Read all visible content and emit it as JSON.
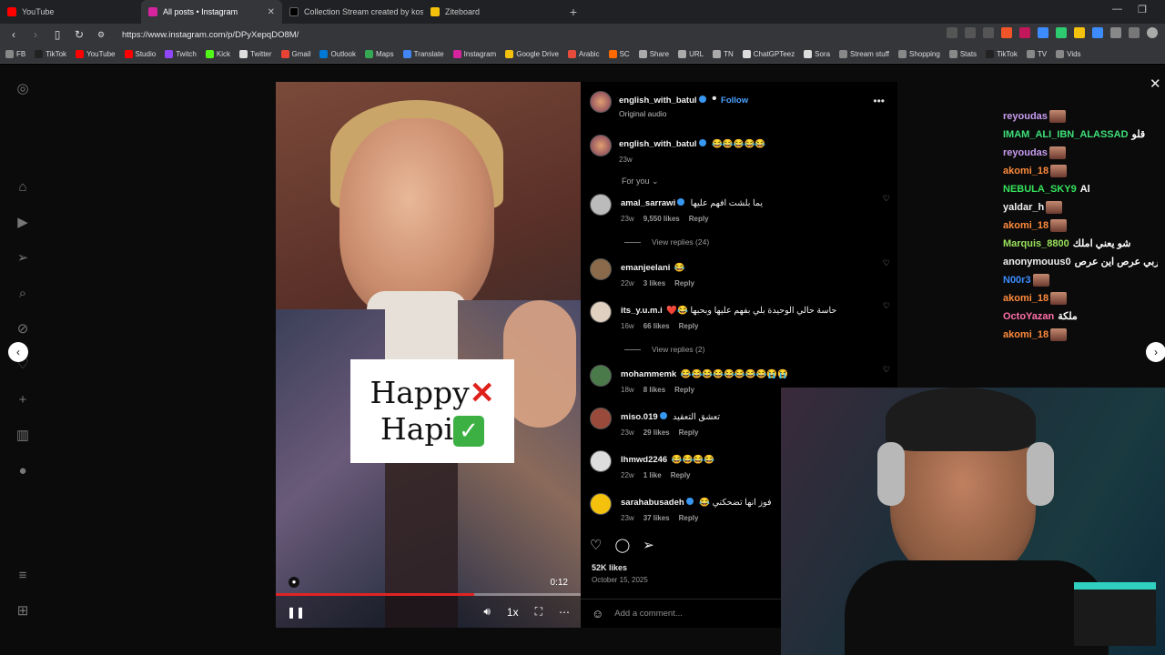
{
  "browser": {
    "tabs": [
      {
        "title": "YouTube",
        "color": "#ff0000",
        "active": false
      },
      {
        "title": "All posts • Instagram",
        "color": "#d6249f",
        "active": true
      },
      {
        "title": "Collection Stream created by kosay.k",
        "color": "#000000",
        "active": false
      },
      {
        "title": "Ziteboard",
        "color": "#f4c20d",
        "active": false
      }
    ],
    "new_tab": "+",
    "url": "https://www.instagram.com/p/DPyXepqDO8M/",
    "bookmarks": [
      "FB",
      "TikTok",
      "YouTube",
      "Studio",
      "Twitch",
      "Kick",
      "Twitter",
      "Gmail",
      "Outlook",
      "Maps",
      "Translate",
      "Instagram",
      "Google Drive",
      "Arabic",
      "SC",
      "Share",
      "URL",
      "TN",
      "ChatGPTeez",
      "Sora",
      "Stream stuff",
      "Shopping",
      "Stats",
      "TikTok",
      "TV",
      "Vids"
    ]
  },
  "video": {
    "sticker_line1": "Happy",
    "sticker_line2": "Hapi",
    "time": "0:12",
    "progress_fraction": 0.65,
    "speed": "1x"
  },
  "post": {
    "author": "english_with_batul",
    "follow": "Follow",
    "audio": "Original audio",
    "caption_author": "english_with_batul",
    "caption_text": "😂😂😂😂😂",
    "caption_age": "23w",
    "for_you": "For you ⌄",
    "likes": "52K likes",
    "date": "October 15, 2025",
    "add_comment_placeholder": "Add a comment..."
  },
  "comments": [
    {
      "user": "amal_sarrawi",
      "verified": true,
      "text": "يما بلشت افهم عليها",
      "age": "23w",
      "likes": "9,550 likes",
      "reply": "Reply",
      "replies": "View replies (24)"
    },
    {
      "user": "emanjeelani",
      "verified": false,
      "text": "😂",
      "age": "22w",
      "likes": "3 likes",
      "reply": "Reply",
      "replies": ""
    },
    {
      "user": "its_y.u.m.i",
      "verified": false,
      "text": "❤️😂 حاسة حالي الوحيدة بلي بفهم عليها وبحبها",
      "age": "16w",
      "likes": "66 likes",
      "reply": "Reply",
      "replies": "View replies (2)"
    },
    {
      "user": "mohammemk",
      "verified": false,
      "text": "😂😂😂😂😂😂😂😂😭😭",
      "age": "18w",
      "likes": "8 likes",
      "reply": "Reply",
      "replies": ""
    },
    {
      "user": "miso.019",
      "verified": true,
      "text": "تعشق التعقيد",
      "age": "23w",
      "likes": "29 likes",
      "reply": "Reply",
      "replies": ""
    },
    {
      "user": "lhmwd2246",
      "verified": false,
      "text": "😂😂😂😂",
      "age": "22w",
      "likes": "1 like",
      "reply": "Reply",
      "replies": ""
    },
    {
      "user": "sarahabusadeh",
      "verified": true,
      "text": "😂 فوز انها تضحكني",
      "age": "23w",
      "likes": "37 likes",
      "reply": "Reply",
      "replies": ""
    }
  ],
  "chat": [
    {
      "user": "reyoudas",
      "color": "#c89cf0",
      "msg": ""
    },
    {
      "user": "IMAM_ALI_IBN_ALASSAD",
      "color": "#3ee07a",
      "msg": "قلو"
    },
    {
      "user": "reyoudas",
      "color": "#c89cf0",
      "msg": ""
    },
    {
      "user": "akomi_18",
      "color": "#ff8a3d",
      "msg": ""
    },
    {
      "user": "NEBULA_SKY9",
      "color": "#35e35c",
      "msg": "Al"
    },
    {
      "user": "yaldar_h",
      "color": "#f0f0f0",
      "msg": ""
    },
    {
      "user": "akomi_18",
      "color": "#ff8a3d",
      "msg": ""
    },
    {
      "user": "Marquis_8800",
      "color": "#9be35c",
      "msg": "شو يعني املك"
    },
    {
      "user": "anonymouus0",
      "color": "#f0f0f0",
      "msg": "يلعن ربي عرص اين عرص"
    },
    {
      "user": "N00r3",
      "color": "#3d8cff",
      "msg": ""
    },
    {
      "user": "akomi_18",
      "color": "#ff8a3d",
      "msg": ""
    },
    {
      "user": "OctoYazan",
      "color": "#ff6fa8",
      "msg": "ملكة"
    },
    {
      "user": "akomi_18",
      "color": "#ff8a3d",
      "msg": ""
    }
  ]
}
